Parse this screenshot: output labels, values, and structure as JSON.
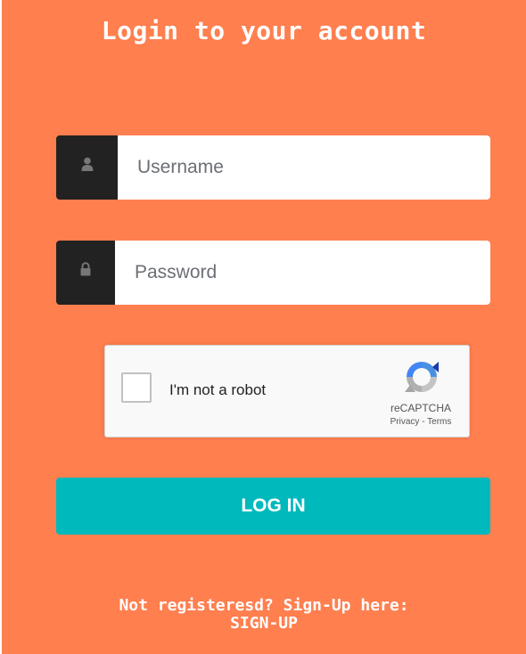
{
  "title": "Login to your account",
  "username": {
    "placeholder": "Username",
    "value": "",
    "icon": "user-icon"
  },
  "password": {
    "placeholder": "Password",
    "value": "",
    "icon": "lock-icon"
  },
  "captcha": {
    "label": "I'm not a robot",
    "brand": "reCAPTCHA",
    "privacy": "Privacy",
    "separator": " - ",
    "terms": "Terms"
  },
  "login_button": "LOG IN",
  "footer": {
    "prompt": "Not registeresd? Sign-Up here:",
    "link": "SIGN-UP"
  },
  "colors": {
    "background": "#ff7f4f",
    "button": "#00b9bd",
    "addon": "#222222"
  }
}
